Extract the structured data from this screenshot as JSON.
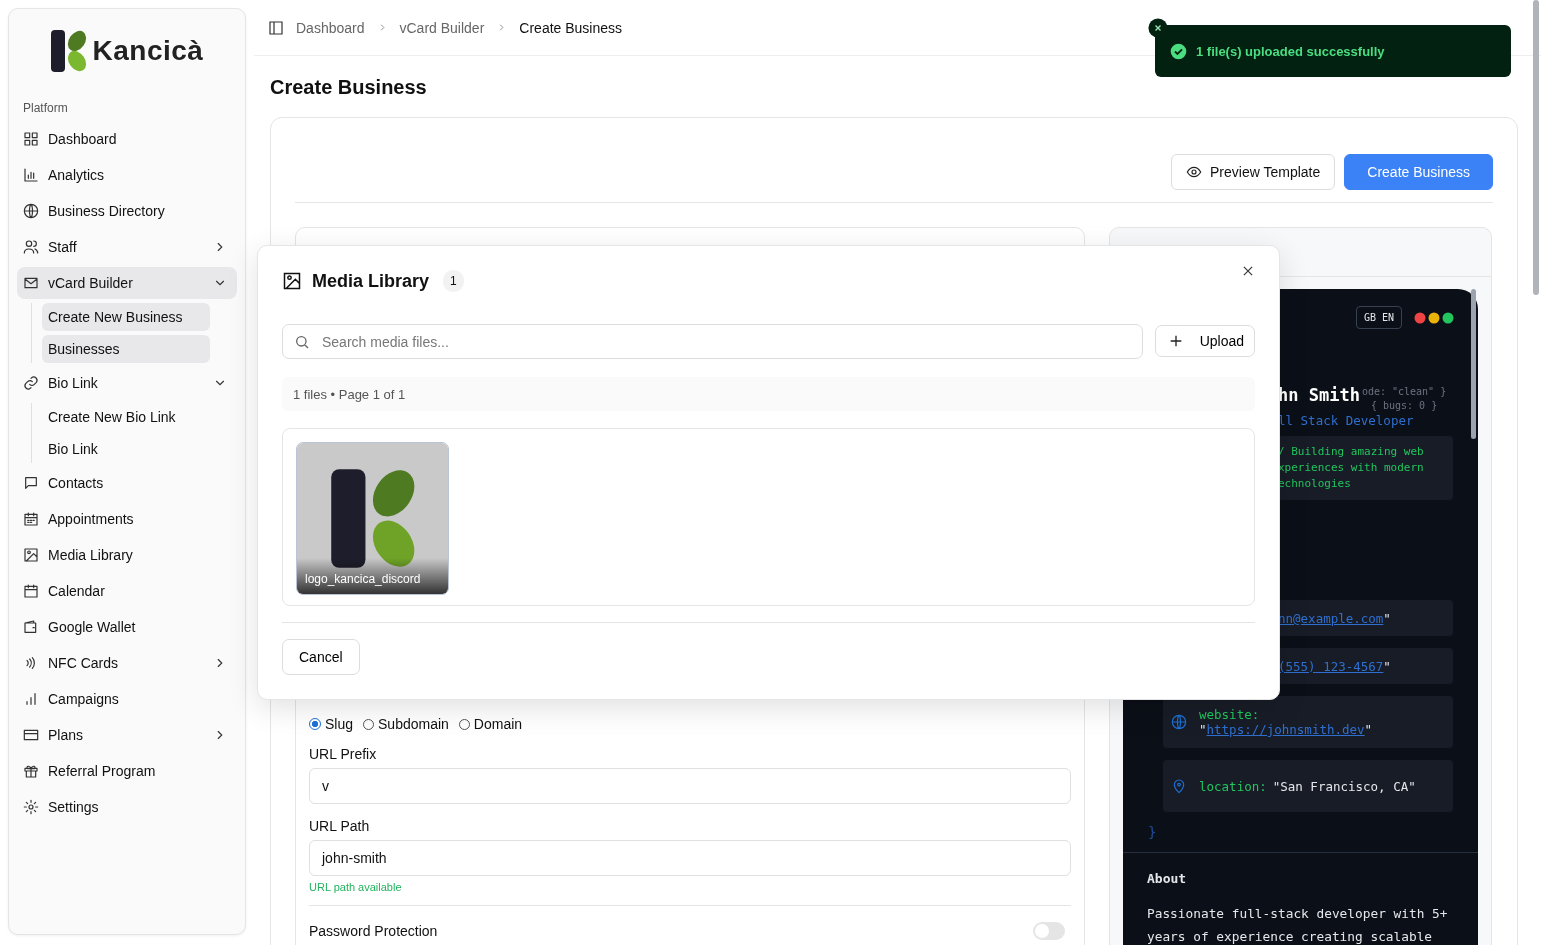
{
  "brand": {
    "name": "Kancicà"
  },
  "sidebar": {
    "section": "Platform",
    "items": [
      {
        "label": "Dashboard",
        "selected": false
      },
      {
        "label": "Analytics",
        "selected": false
      },
      {
        "label": "Business Directory",
        "selected": false
      },
      {
        "label": "Staff",
        "selected": false,
        "expanded": false
      },
      {
        "label": "vCard Builder",
        "selected": true,
        "expanded": true,
        "children": [
          {
            "label": "Create New Business",
            "selected": true
          },
          {
            "label": "Businesses",
            "selected": true
          }
        ]
      },
      {
        "label": "Bio Link",
        "selected": false,
        "expanded": true,
        "children": [
          {
            "label": "Create New Bio Link",
            "selected": false
          },
          {
            "label": "Bio Link",
            "selected": false
          }
        ]
      },
      {
        "label": "Contacts",
        "selected": false
      },
      {
        "label": "Appointments",
        "selected": false
      },
      {
        "label": "Media Library",
        "selected": false
      },
      {
        "label": "Calendar",
        "selected": false
      },
      {
        "label": "Google Wallet",
        "selected": false
      },
      {
        "label": "NFC Cards",
        "selected": false,
        "expanded": false
      },
      {
        "label": "Campaigns",
        "selected": false
      },
      {
        "label": "Plans",
        "selected": false,
        "expanded": false
      },
      {
        "label": "Referral Program",
        "selected": false
      },
      {
        "label": "Settings",
        "selected": false
      }
    ]
  },
  "breadcrumb": [
    "Dashboard",
    "vCard Builder",
    "Create Business"
  ],
  "page_title": "Create Business",
  "toolbar": [
    {
      "label": "Preview Template",
      "kind": "secondary"
    },
    {
      "label": "Create Business",
      "kind": "primary"
    }
  ],
  "form": {
    "url_type": [
      {
        "label": "Slug",
        "selected": true
      },
      {
        "label": "Subdomain",
        "selected": false
      },
      {
        "label": "Domain",
        "selected": false
      }
    ],
    "fields": [
      {
        "label": "URL Prefix",
        "value": "v"
      },
      {
        "label": "URL Path",
        "value": "john-smith",
        "hint": "URL path available"
      }
    ],
    "password_protection": {
      "label": "Password Protection",
      "on": false
    }
  },
  "preview": {
    "language": "GB EN",
    "name": "hn Smith",
    "code_comments": [
      "ode: \"clean\" }",
      "{ bugs: 0 }"
    ],
    "title": "ll Stack Developer",
    "bio_lines": [
      "/ Building amazing web",
      "xperiences with modern",
      "echnologies"
    ],
    "contacts": [
      {
        "kind": "email",
        "link": "nn@example.com",
        "after": "\""
      },
      {
        "kind": "phone",
        "link": "(555) 123-4567",
        "after": "\""
      },
      {
        "kind": "website",
        "key": "website:",
        "before": "\"",
        "link": "https://johnsmith.dev",
        "after": "\""
      },
      {
        "kind": "location",
        "key": "location:",
        "value": "\"San Francisco, CA\""
      }
    ],
    "closing": "}",
    "about_heading": "About",
    "about_text": "Passionate full-stack developer with 5+ years of experience creating scalable"
  },
  "modal": {
    "title": "Media Library",
    "count": "1",
    "search_placeholder": "Search media files...",
    "upload": "Upload",
    "info": "1 files • Page 1 of 1",
    "files": [
      {
        "name": "logo_kancica_discord"
      }
    ],
    "cancel": "Cancel"
  },
  "toast": {
    "kind": "success",
    "message": "1 file(s) uploaded successfully"
  }
}
